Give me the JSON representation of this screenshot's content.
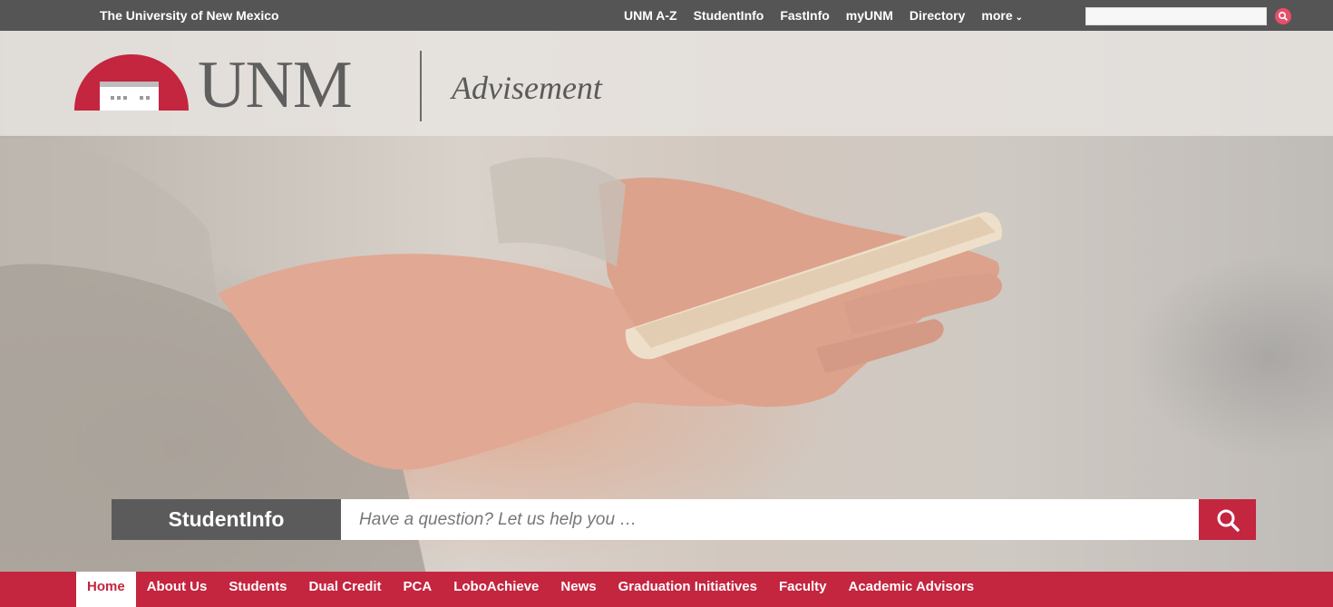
{
  "topbar": {
    "university": "The University of New Mexico",
    "links": [
      "UNM A-Z",
      "StudentInfo",
      "FastInfo",
      "myUNM",
      "Directory"
    ],
    "more_label": "more",
    "more_icon": "chevron-down-icon",
    "search_icon": "search-icon"
  },
  "header": {
    "logo_text": "UNM",
    "site_name": "Advisement"
  },
  "search": {
    "label": "StudentInfo",
    "placeholder": "Have a question? Let us help you …",
    "button_icon": "search-icon"
  },
  "nav": {
    "items": [
      "Home",
      "About Us",
      "Students",
      "Dual Credit",
      "PCA",
      "LoboAchieve",
      "News",
      "Graduation Initiatives",
      "Faculty",
      "Academic Advisors"
    ],
    "active": "Home"
  },
  "colors": {
    "brand_red": "#c4253f",
    "topbar_gray": "#555555",
    "label_gray": "#5b5b5b"
  }
}
